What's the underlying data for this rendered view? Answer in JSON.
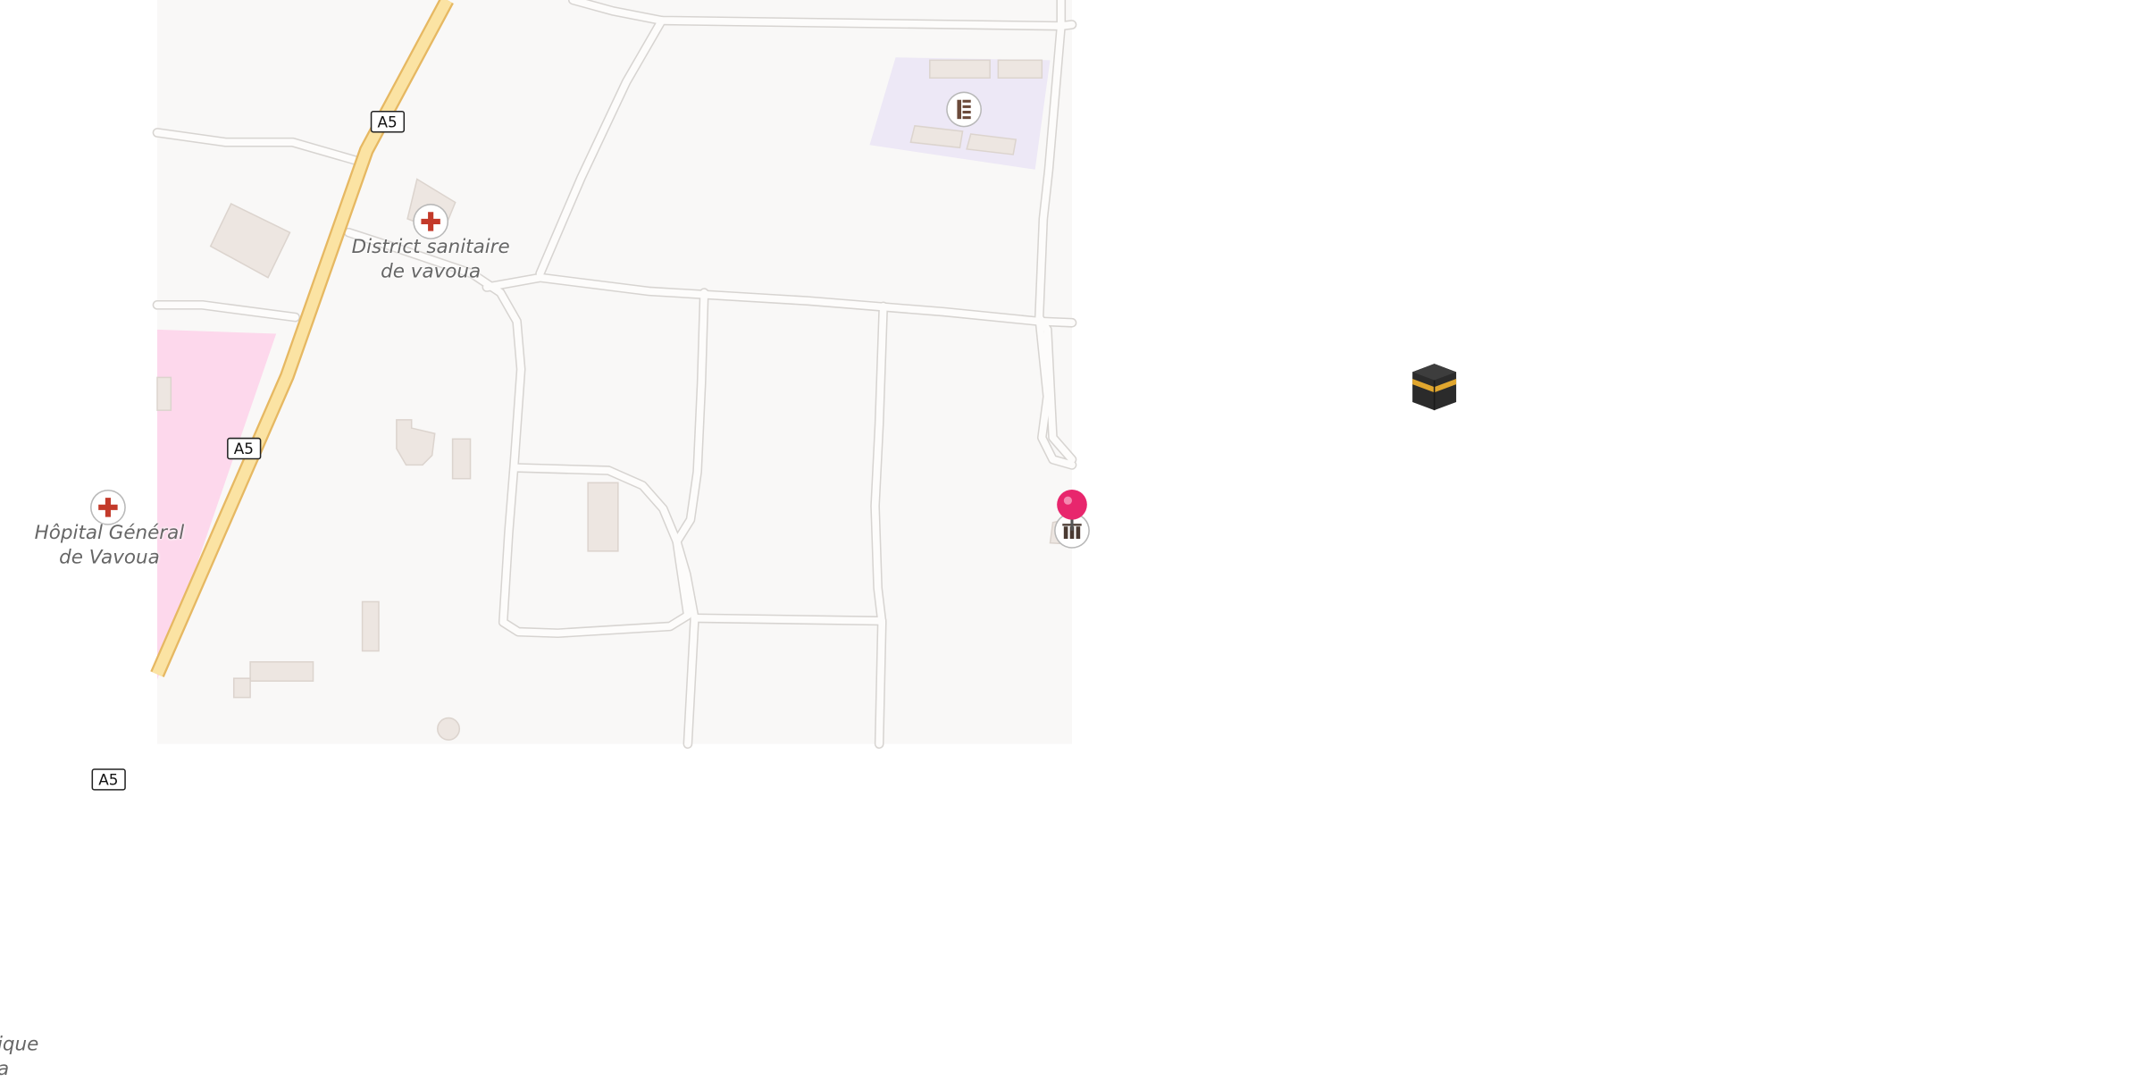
{
  "map": {
    "roads": [
      {
        "ref": "A5"
      },
      {
        "ref": "A5"
      },
      {
        "ref": "A5"
      }
    ],
    "places": [
      {
        "name_line1": "District sanitaire",
        "name_line2": "de vavoua",
        "icon": "hospital-cross-icon"
      },
      {
        "name_line1": "Hôpital Général",
        "name_line2": "de Vavoua",
        "icon": "hospital-cross-icon"
      },
      {
        "name_line1": "ique",
        "name_line2": "a",
        "icon": ""
      }
    ],
    "pois": [
      {
        "type": "school",
        "icon": "school-icon"
      },
      {
        "type": "museum",
        "icon": "museum-icon"
      },
      {
        "type": "place-of-worship",
        "icon": "kaaba-icon"
      }
    ],
    "marker": {
      "icon": "location-pin-icon",
      "color": "#e8266d"
    },
    "colors": {
      "land": "#f9f8f7",
      "road_casing": "#d7d4d1",
      "motorway_fill": "#fbe3a3",
      "motorway_casing": "#e6b862",
      "hospital_area": "#fdd8ec",
      "school_area": "#ede8f6",
      "building": "#ede6e1",
      "cross": "#c33a2a"
    }
  }
}
